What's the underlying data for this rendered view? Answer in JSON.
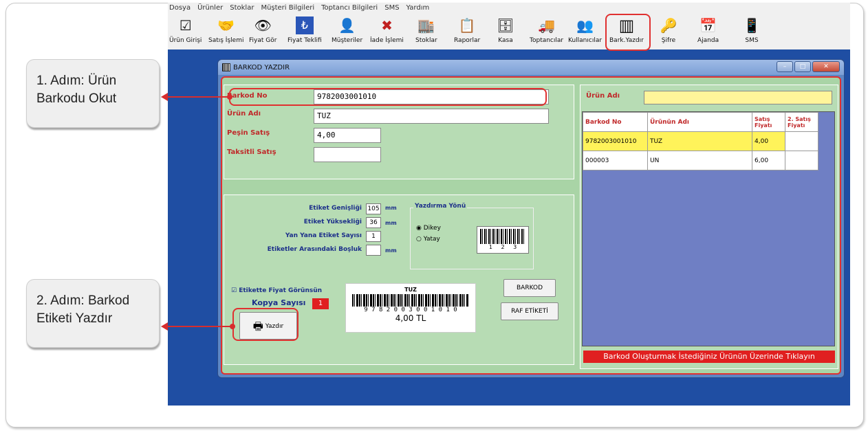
{
  "menu": [
    "Dosya",
    "Ürünler",
    "Stoklar",
    "Müşteri Bilgileri",
    "Toptancı Bilgileri",
    "SMS",
    "Yardım"
  ],
  "toolbar": [
    {
      "label": "Ürün Girişi",
      "icon": "☑"
    },
    {
      "label": "Satış İşlemi",
      "icon": "🤝"
    },
    {
      "label": "Fiyat Gör",
      "icon": "👁"
    },
    {
      "label": "Fiyat Teklifi",
      "icon": "₺"
    },
    {
      "label": "Müşteriler",
      "icon": "👤"
    },
    {
      "label": "İade İşlemi",
      "icon": "✖"
    },
    {
      "label": "Stoklar",
      "icon": "🏬"
    },
    {
      "label": "Raporlar",
      "icon": "📋"
    },
    {
      "label": "Kasa",
      "icon": "🗄"
    },
    {
      "label": "Toptancılar",
      "icon": "🚚"
    },
    {
      "label": "Kullanıcılar",
      "icon": "👥"
    },
    {
      "label": "Bark.Yazdır",
      "icon": "▥"
    },
    {
      "label": "Şifre",
      "icon": "🔑"
    },
    {
      "label": "Ajanda",
      "icon": "📅"
    },
    {
      "label": "SMS",
      "icon": "📱"
    }
  ],
  "dialog": {
    "title": "BARKOD YAZDIR",
    "barkod_no_label": "Barkod No",
    "barkod_no_value": "9782003001010",
    "urun_adi_label": "Ürün Adı",
    "urun_adi_value": "TUZ",
    "pesin_label": "Peşin Satış",
    "pesin_value": "4,00",
    "taksitli_label": "Taksitli Satış",
    "taksitli_value": "",
    "etiket_genisligi_label": "Etiket Genişliği",
    "etiket_genisligi_value": "105",
    "etiket_yuksekligi_label": "Etiket Yüksekliği",
    "etiket_yuksekligi_value": "36",
    "yan_yana_label": "Yan Yana Etiket Sayısı",
    "yan_yana_value": "1",
    "bosluk_label": "Etiketler Arasındaki Boşluk",
    "bosluk_value": "",
    "mm": "mm",
    "yazdirma_yonu_label": "Yazdırma Yönü",
    "dikey": "Dikey",
    "yatay": "Yatay",
    "barcode_digits": "1 2 3",
    "fiyat_gorunsun": "Etikette Fiyat Görünsün",
    "kopya_label": "Kopya Sayısı",
    "kopya_value": "1",
    "yazdir_btn": "Yazdır",
    "preview_name": "TUZ",
    "preview_digits": "9 7 8 2 0 0 3 0 0 1 0 1 0",
    "preview_price": "4,00 TL",
    "barkod_btn": "BARKOD",
    "raf_btn": "RAF ETİKETİ",
    "search_label": "Ürün Adı",
    "search_value": "",
    "grid_headers": [
      "Barkod No",
      "Ürünün Adı",
      "Satış Fiyatı",
      "2. Satış Fiyatı"
    ],
    "grid_rows": [
      [
        "9782003001010",
        "TUZ",
        "4,00",
        ""
      ],
      [
        "000003",
        "UN",
        "6,00",
        ""
      ]
    ],
    "status": "Barkod Oluşturmak İstediğiniz Ürünün Üzerinde Tıklayın"
  },
  "callouts": {
    "step1": "1. Adım: Ürün Barkodu Okut",
    "step2": "2. Adım: Barkod Etiketi Yazdır"
  },
  "colors": {
    "accent_red": "#e03030",
    "desktop_blue": "#1f4ea3",
    "panel_green": "#a9d4a6",
    "grid_purple": "#6f7fc4",
    "highlight_yellow": "#fff35a"
  }
}
